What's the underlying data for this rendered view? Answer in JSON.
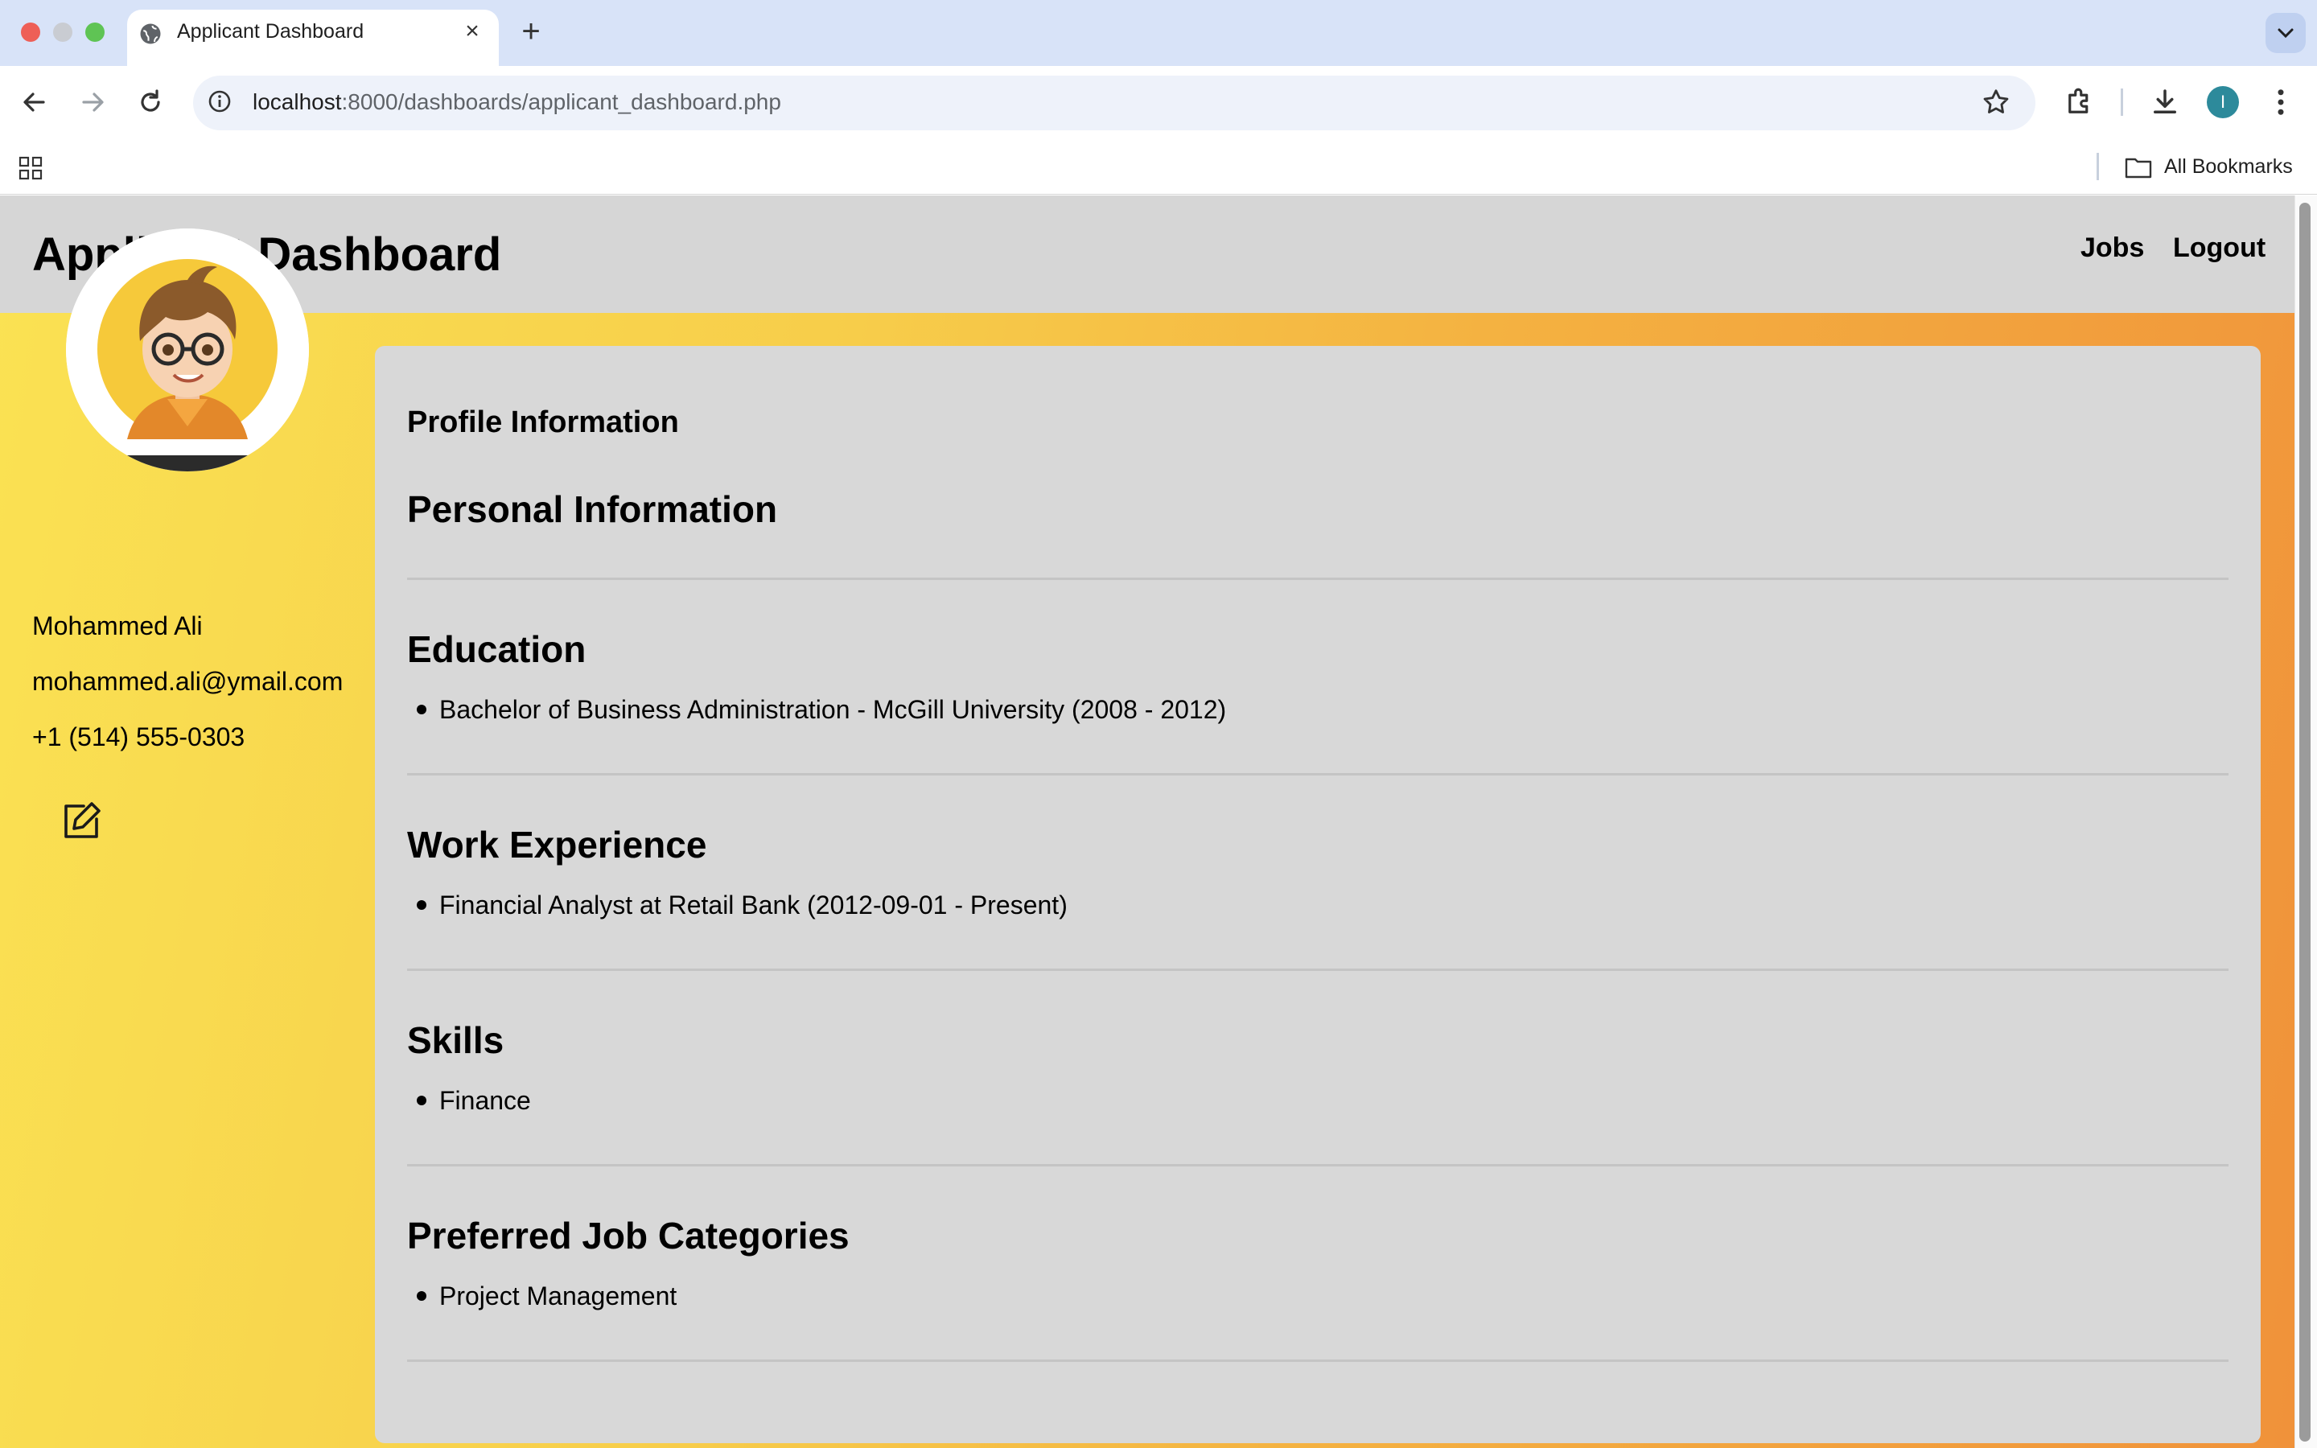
{
  "browser": {
    "tab_title": "Applicant Dashboard",
    "url_host": "localhost",
    "url_path": ":8000/dashboards/applicant_dashboard.php",
    "profile_initial": "I",
    "bookmarks_label": "All Bookmarks"
  },
  "header": {
    "title": "Applicant Dashboard",
    "nav": [
      "Jobs",
      "Logout"
    ]
  },
  "profile": {
    "name": "Mohammed Ali",
    "email": "mohammed.ali@ymail.com",
    "phone": "+1 (514) 555-0303"
  },
  "main": {
    "heading": "Profile Information",
    "sections": [
      {
        "title": "Personal Information",
        "items": []
      },
      {
        "title": "Education",
        "items": [
          "Bachelor of Business Administration - McGill University (2008 - 2012)"
        ]
      },
      {
        "title": "Work Experience",
        "items": [
          "Financial Analyst at Retail Bank (2012-09-01 - Present)"
        ]
      },
      {
        "title": "Skills",
        "items": [
          "Finance"
        ]
      },
      {
        "title": "Preferred Job Categories",
        "items": [
          "Project Management"
        ]
      }
    ]
  },
  "colors": {
    "header_bg": "#d6d6d6",
    "card_bg": "#d8d8d8",
    "gradient_start": "#fae253",
    "gradient_end": "#f0923a"
  }
}
